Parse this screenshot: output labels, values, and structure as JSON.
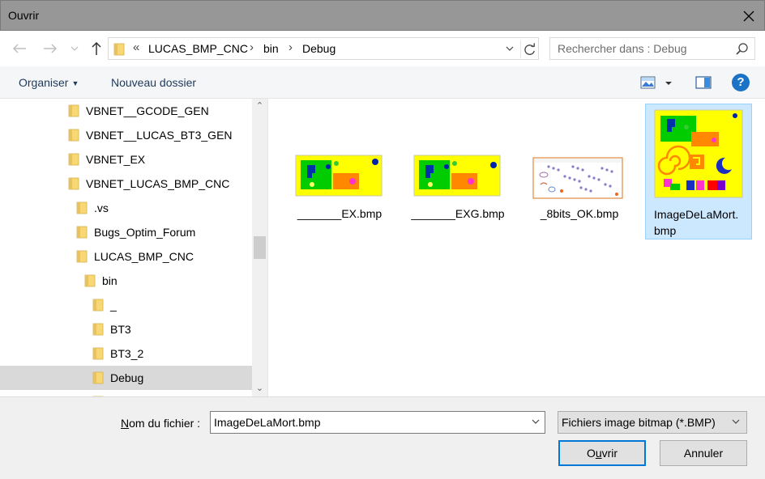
{
  "window": {
    "title": "Ouvrir"
  },
  "address": {
    "overflow": "«",
    "segments": [
      "LUCAS_BMP_CNC",
      "bin",
      "Debug"
    ]
  },
  "search": {
    "placeholder": "Rechercher dans : Debug"
  },
  "toolbar": {
    "organize": "Organiser",
    "new_folder": "Nouveau dossier",
    "help": "?"
  },
  "tree": {
    "items": [
      {
        "label": "VBNET__GCODE_GEN",
        "depth": 0
      },
      {
        "label": "VBNET__LUCAS_BT3_GEN",
        "depth": 0
      },
      {
        "label": "VBNET_EX",
        "depth": 0
      },
      {
        "label": "VBNET_LUCAS_BMP_CNC",
        "depth": 0
      },
      {
        "label": ".vs",
        "depth": 1
      },
      {
        "label": "Bugs_Optim_Forum",
        "depth": 1
      },
      {
        "label": "LUCAS_BMP_CNC",
        "depth": 1
      },
      {
        "label": "bin",
        "depth": 2
      },
      {
        "label": "_",
        "depth": 3
      },
      {
        "label": "BT3",
        "depth": 3
      },
      {
        "label": "BT3_2",
        "depth": 3
      },
      {
        "label": "Debug",
        "depth": 3,
        "selected": true
      }
    ]
  },
  "files": [
    {
      "name": "_______EX.bmp",
      "kind": "yellow-small"
    },
    {
      "name": "_______EXG.bmp",
      "kind": "yellow-small"
    },
    {
      "name": "_8bits_OK.bmp",
      "kind": "white-dots"
    },
    {
      "name": "ImageDeLaMort.bmp",
      "name_line1": "ImageDeLaMort.",
      "name_line2": "bmp",
      "kind": "yellow-big",
      "selected": true
    }
  ],
  "bottom": {
    "filename_label_underline": "N",
    "filename_label_rest": "om du fichier :",
    "filename_value": "ImageDeLaMort.bmp",
    "filetype_value": "Fichiers image bitmap (*.BMP)",
    "open_underline": "u",
    "open_pre": "O",
    "open_rest": "vrir",
    "cancel": "Annuler"
  },
  "colors": {
    "accent": "#0078d7",
    "folder": "#f8d775",
    "selection": "#cce8ff",
    "thumb_yellow": "#ffff00",
    "thumb_green": "#00cc00"
  }
}
